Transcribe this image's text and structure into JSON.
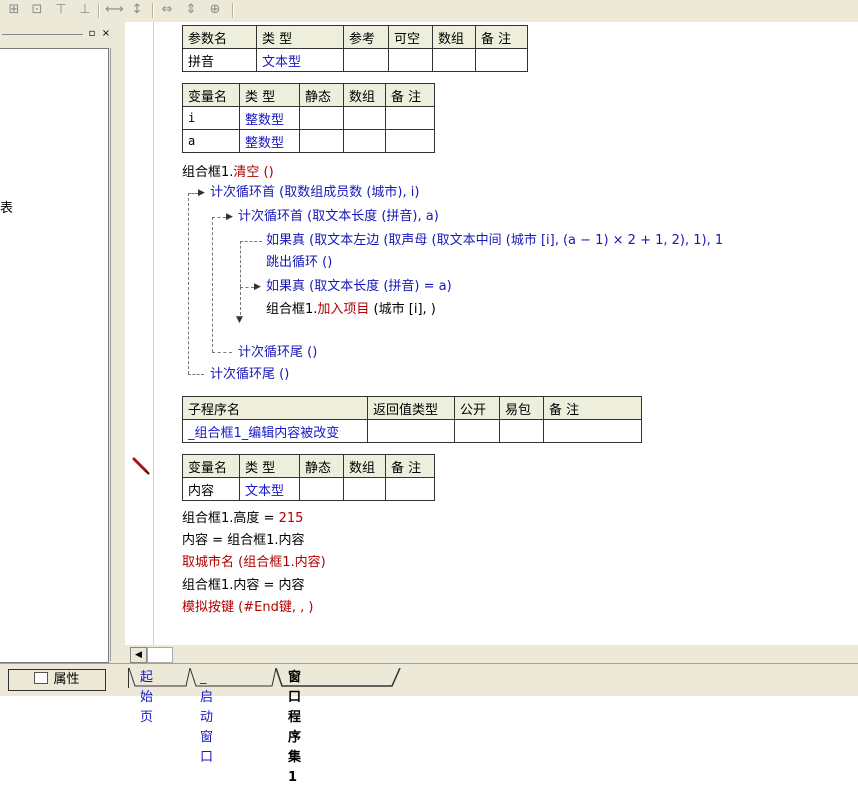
{
  "left_panel": {
    "pin_glyph": "▫",
    "close_glyph": "×",
    "truncated_text": "表"
  },
  "table_params": {
    "headers": [
      "参数名",
      "类 型",
      "参考",
      "可空",
      "数组",
      "备 注"
    ],
    "rows": [
      [
        "拼音",
        "文本型",
        "",
        "",
        "",
        ""
      ]
    ]
  },
  "table_vars1": {
    "headers": [
      "变量名",
      "类 型",
      "静态",
      "数组",
      "备 注"
    ],
    "rows": [
      [
        "i",
        "整数型",
        "",
        "",
        ""
      ],
      [
        "a",
        "整数型",
        "",
        "",
        ""
      ]
    ]
  },
  "code1": {
    "line1_obj": "组合框1.",
    "line1_fn": "清空",
    "line1_rest": " ()",
    "loop1_cmd": "计次循环首",
    "loop1_args": " (取数组成员数 (城市), i)",
    "loop2_cmd": "计次循环首",
    "loop2_args": " (取文本长度 (拼音), a)",
    "if1_cmd": "如果真",
    "if1_args": " (取文本左边 (取声母 (取文本中间 (城市 [i], (a − 1) × 2 + 1, 2), 1), 1",
    "break_cmd": "跳出循环",
    "break_args": " ()",
    "if2_cmd": "如果真",
    "if2_args": " (取文本长度 (拼音) = a)",
    "add_obj": "组合框1.",
    "add_fn": "加入项目",
    "add_args": " (城市 [i], )",
    "loop2_end": "计次循环尾",
    "loop2_end_args": " ()",
    "loop1_end": "计次循环尾",
    "loop1_end_args": " ()"
  },
  "table_sub": {
    "headers": [
      "子程序名",
      "返回值类型",
      "公开",
      "易包",
      "备 注"
    ],
    "rows": [
      [
        "_组合框1_编辑内容被改变",
        "",
        "",
        "",
        ""
      ]
    ]
  },
  "table_vars2": {
    "headers": [
      "变量名",
      "类 型",
      "静态",
      "数组",
      "备 注"
    ],
    "rows": [
      [
        "内容",
        "文本型",
        "",
        "",
        ""
      ]
    ]
  },
  "code2": {
    "l1_a": "组合框1.高度 = ",
    "l1_b": "215",
    "l2": "内容 = 组合框1.内容",
    "l3_fn": "取城市名",
    "l3_args": " (组合框1.内容)",
    "l4": "组合框1.内容 = 内容",
    "l5_fn": "模拟按键",
    "l5_args": " (#End键, , )"
  },
  "bottom": {
    "properties_label": "属性",
    "tabs": [
      "起始页",
      "_启动窗口",
      "窗口程序集1"
    ]
  },
  "colors": {
    "type_blue": "#1818c8",
    "func_red": "#b00000",
    "header_bg": "#eeeedd",
    "chrome": "#ece9d8"
  }
}
